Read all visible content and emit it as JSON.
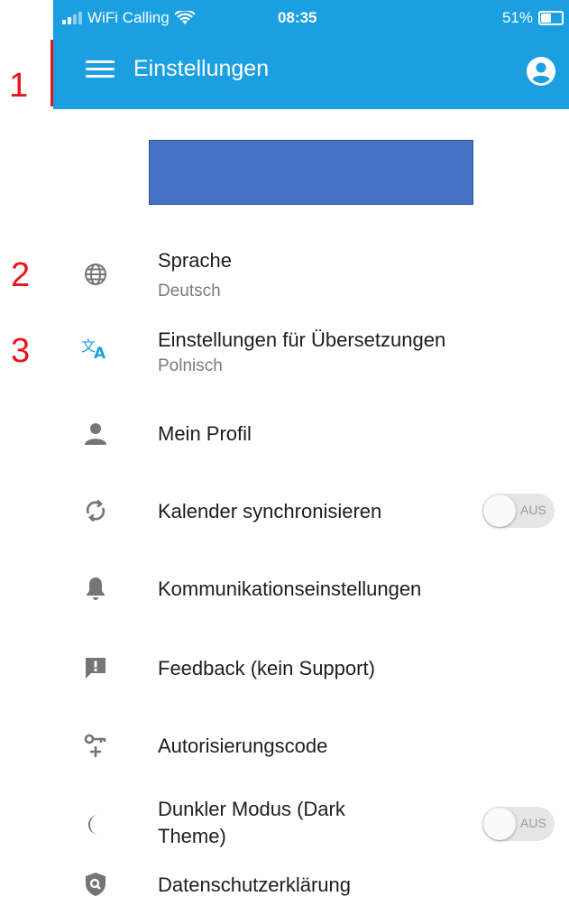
{
  "annotations": [
    "1",
    "2",
    "3"
  ],
  "statusbar": {
    "carrier": "WiFi Calling",
    "time": "08:35",
    "battery_text": "51%",
    "battery_level": 0.51
  },
  "appbar": {
    "title": "Einstellungen",
    "menu_icon": "hamburger-menu-icon",
    "account_icon": "account-circle-icon"
  },
  "colors": {
    "primary": "#1a9fe0",
    "annotation": "#e8141b",
    "logo_placeholder": "#4472c4",
    "icon_gray": "#757575",
    "icon_accent": "#1a9fe0"
  },
  "settings": [
    {
      "icon": "globe-icon",
      "label": "Sprache",
      "sub": "Deutsch"
    },
    {
      "icon": "translate-icon",
      "label": "Einstellungen für Übersetzungen",
      "sub": "Polnisch"
    },
    {
      "icon": "person-icon",
      "label": "Mein Profil"
    },
    {
      "icon": "sync-icon",
      "label": "Kalender synchronisieren",
      "toggle": "AUS",
      "toggle_on": false
    },
    {
      "icon": "bell-icon",
      "label": "Kommunikationseinstellungen"
    },
    {
      "icon": "feedback-icon",
      "label": "Feedback (kein Support)"
    },
    {
      "icon": "key-plus-icon",
      "label": "Autorisierungscode"
    },
    {
      "icon": "moon-icon",
      "label": "Dunkler Modus (Dark",
      "label2": "Theme)",
      "toggle": "AUS",
      "toggle_on": false
    },
    {
      "icon": "shield-icon",
      "label": "Datenschutzerklärung"
    }
  ]
}
